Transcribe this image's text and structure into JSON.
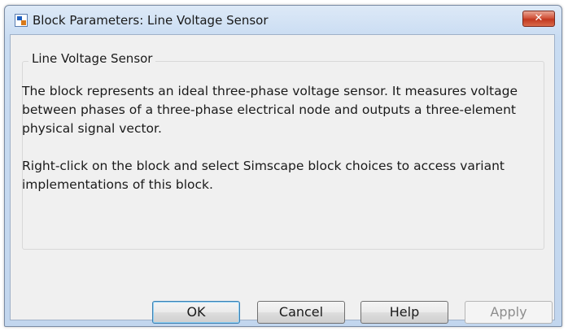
{
  "window": {
    "title": "Block Parameters: Line Voltage Sensor",
    "close_label": "✕"
  },
  "group": {
    "label": "Line Voltage Sensor"
  },
  "description": {
    "paragraph1": "The block represents an ideal three-phase voltage sensor. It measures voltage between phases of a three-phase electrical node and outputs a three-element physical signal vector.",
    "paragraph2": "Right-click on the block and select Simscape block choices to access variant implementations of this block."
  },
  "buttons": {
    "ok": "OK",
    "cancel": "Cancel",
    "help": "Help",
    "apply": "Apply"
  },
  "colors": {
    "title_bar": "#c9dcf2",
    "close_button": "#c2381f",
    "dialog_background": "#f0f0f0"
  },
  "icons": [
    "simulink-block-icon",
    "close-icon"
  ]
}
